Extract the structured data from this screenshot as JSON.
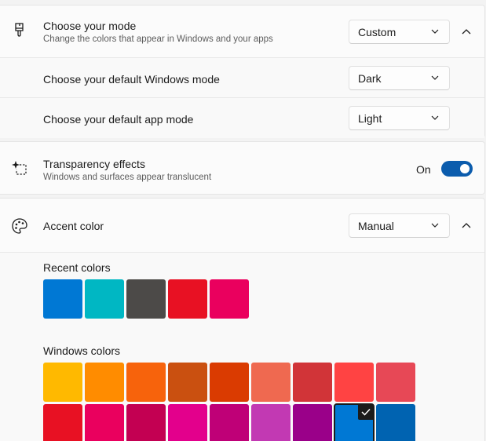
{
  "mode": {
    "title": "Choose your mode",
    "description": "Change the colors that appear in Windows and your apps",
    "value": "Custom",
    "icon": "paintbrush-icon",
    "windows_mode": {
      "label": "Choose your default Windows mode",
      "value": "Dark"
    },
    "app_mode": {
      "label": "Choose your default app mode",
      "value": "Light"
    }
  },
  "transparency": {
    "title": "Transparency effects",
    "description": "Windows and surfaces appear translucent",
    "state_label": "On",
    "enabled": true,
    "icon": "transparency-sparkle-icon"
  },
  "accent": {
    "title": "Accent color",
    "value": "Manual",
    "icon": "palette-icon",
    "recent_label": "Recent colors",
    "recent_colors": [
      "#0078d4",
      "#00b7c3",
      "#4c4a48",
      "#e81123",
      "#ea005e"
    ],
    "windows_label": "Windows colors",
    "windows_colors_row1": [
      "#ffb900",
      "#ff8c00",
      "#f7630c",
      "#ca5010",
      "#da3b01",
      "#ef6950",
      "#d13438",
      "#ff4343",
      "#e74856"
    ],
    "windows_colors_row2": [
      "#e81123",
      "#ea005e",
      "#c30052",
      "#e3008c",
      "#bf0077",
      "#c239b3",
      "#9a0089",
      "#0078d4",
      "#0063b1"
    ],
    "selected_color": "#0078d4"
  },
  "colors": {
    "toggle_on": "#0b5cad",
    "card_bg": "#fbfbfb",
    "page_bg": "#f3f3f3"
  }
}
